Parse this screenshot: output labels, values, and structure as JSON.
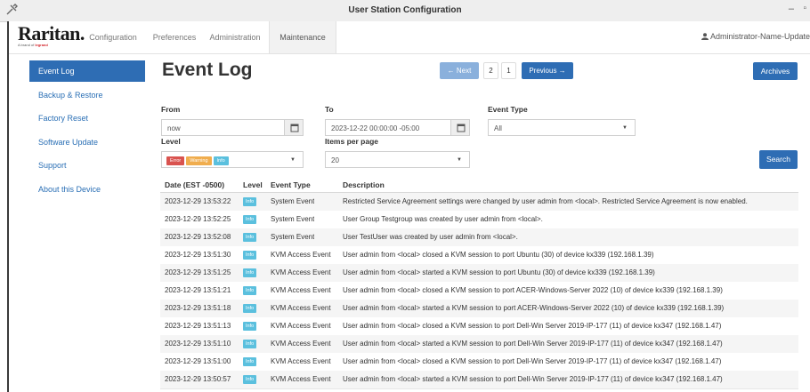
{
  "window": {
    "title": "User Station Configuration",
    "minimize": "–",
    "maximize": "▫"
  },
  "brand": {
    "name": "Raritan.",
    "tagline_prefix": "A brand of",
    "tagline_brand": "legrand"
  },
  "nav": {
    "tabs": [
      "Configuration",
      "Preferences",
      "Administration",
      "Maintenance"
    ],
    "active": "Maintenance",
    "user": "Administrator-Name-Update"
  },
  "sidebar": {
    "items": [
      {
        "label": "Event Log",
        "active": true
      },
      {
        "label": "Backup & Restore"
      },
      {
        "label": "Factory Reset"
      },
      {
        "label": "Software Update"
      },
      {
        "label": "Support"
      },
      {
        "label": "About this Device"
      }
    ]
  },
  "page": {
    "title": "Event Log"
  },
  "pager": {
    "next_label": "← Next",
    "pages": [
      "2",
      "1"
    ],
    "previous_label": "Previous →"
  },
  "archives_label": "Archives",
  "filters": {
    "from_label": "From",
    "from_value": "now",
    "to_label": "To",
    "to_value": "2023-12-22 00:00:00 -05:00",
    "event_type_label": "Event Type",
    "event_type_value": "All",
    "level_label": "Level",
    "level_tags": [
      "Error",
      "Warning",
      "Info"
    ],
    "items_label": "Items per page",
    "items_value": "20",
    "search_label": "Search"
  },
  "table": {
    "headers": [
      "Date (EST -0500)",
      "Level",
      "Event Type",
      "Description"
    ],
    "rows": [
      {
        "date": "2023-12-29 13:53:22",
        "level": "Info",
        "type": "System Event",
        "desc": "Restricted Service Agreement settings were changed by user admin from <local>. Restricted Service Agreement is now enabled."
      },
      {
        "date": "2023-12-29 13:52:25",
        "level": "Info",
        "type": "System Event",
        "desc": "User Group Testgroup was created by user admin from <local>."
      },
      {
        "date": "2023-12-29 13:52:08",
        "level": "Info",
        "type": "System Event",
        "desc": "User TestUser was created by user admin from <local>."
      },
      {
        "date": "2023-12-29 13:51:30",
        "level": "Info",
        "type": "KVM Access Event",
        "desc": "User admin from <local> closed a KVM session to port Ubuntu (30) of device kx339 (192.168.1.39)"
      },
      {
        "date": "2023-12-29 13:51:25",
        "level": "Info",
        "type": "KVM Access Event",
        "desc": "User admin from <local> started a KVM session to port Ubuntu (30) of device kx339 (192.168.1.39)"
      },
      {
        "date": "2023-12-29 13:51:21",
        "level": "Info",
        "type": "KVM Access Event",
        "desc": "User admin from <local> closed a KVM session to port ACER-Windows-Server 2022 (10) of device kx339 (192.168.1.39)"
      },
      {
        "date": "2023-12-29 13:51:18",
        "level": "Info",
        "type": "KVM Access Event",
        "desc": "User admin from <local> started a KVM session to port ACER-Windows-Server 2022 (10) of device kx339 (192.168.1.39)"
      },
      {
        "date": "2023-12-29 13:51:13",
        "level": "Info",
        "type": "KVM Access Event",
        "desc": "User admin from <local> closed a KVM session to port Dell-Win Server 2019-IP-177 (11) of device kx347 (192.168.1.47)"
      },
      {
        "date": "2023-12-29 13:51:10",
        "level": "Info",
        "type": "KVM Access Event",
        "desc": "User admin from <local> started a KVM session to port Dell-Win Server 2019-IP-177 (11) of device kx347 (192.168.1.47)"
      },
      {
        "date": "2023-12-29 13:51:00",
        "level": "Info",
        "type": "KVM Access Event",
        "desc": "User admin from <local> closed a KVM session to port Dell-Win Server 2019-IP-177 (11) of device kx347 (192.168.1.47)"
      },
      {
        "date": "2023-12-29 13:50:57",
        "level": "Info",
        "type": "KVM Access Event",
        "desc": "User admin from <local> started a KVM session to port Dell-Win Server 2019-IP-177 (11) of device kx347 (192.168.1.47)"
      }
    ]
  },
  "colors": {
    "primary": "#2e6db4",
    "link": "#2a6fb5",
    "info": "#5bc0de",
    "error": "#d9534f",
    "warning": "#f0ad4e"
  }
}
